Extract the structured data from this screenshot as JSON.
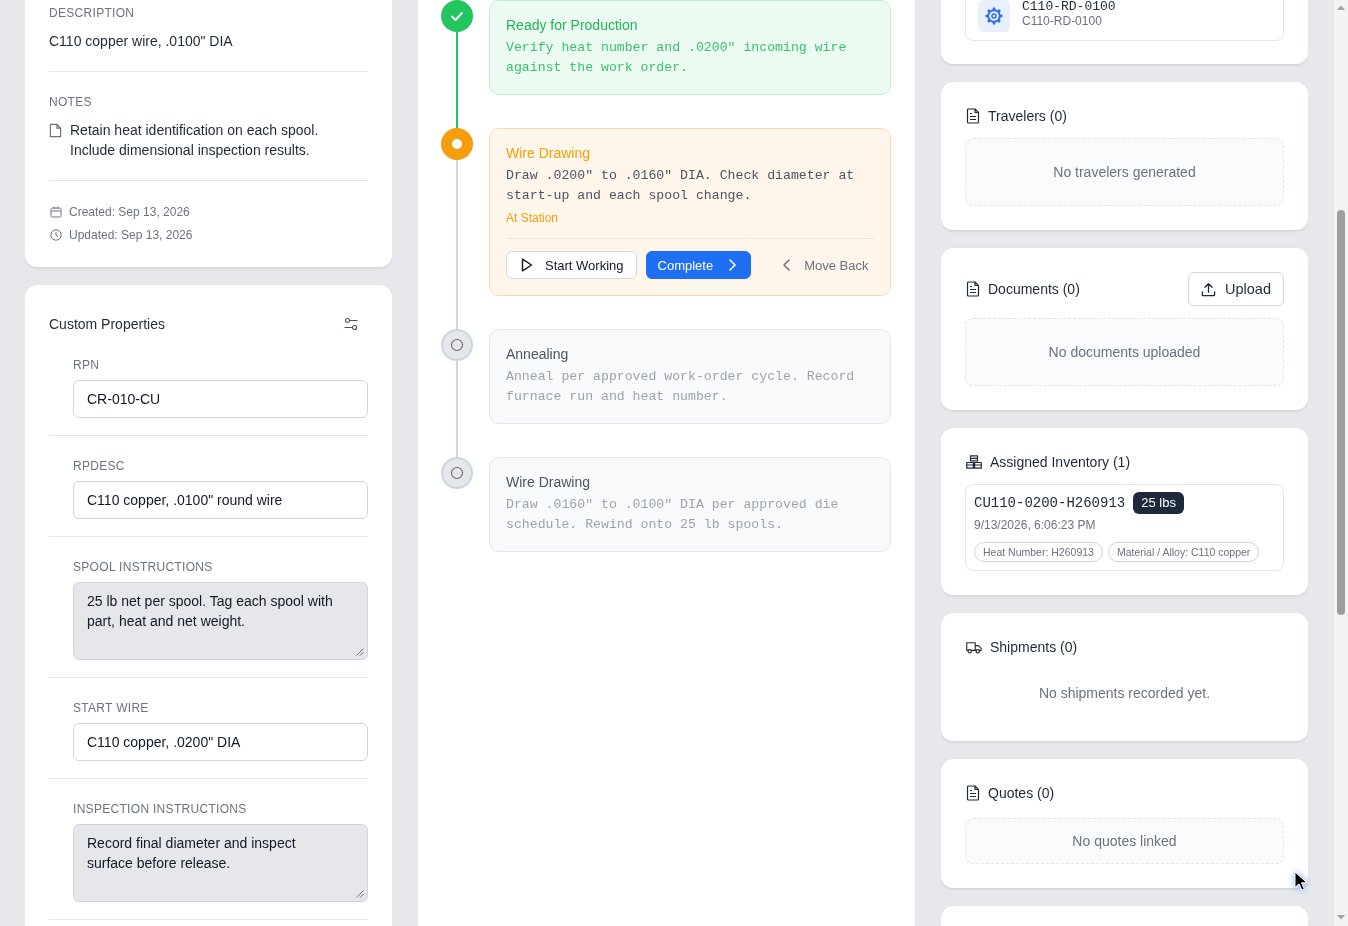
{
  "details": {
    "fields": [
      {
        "label": "DESCRIPTION",
        "value": "C110 copper wire, .0100\" DIA",
        "kind": "text"
      },
      {
        "label": "NOTES",
        "value": "Retain heat identification on each spool. Include dimensional inspection results.",
        "kind": "note"
      }
    ],
    "meta": [
      {
        "kind": "created",
        "text": "Created: Sep 13, 2026"
      },
      {
        "kind": "updated",
        "text": "Updated: Sep 13, 2026"
      }
    ]
  },
  "custom_properties": {
    "title": "Custom Properties",
    "properties": [
      {
        "label": "RPN",
        "value": "CR-010-CU",
        "kind": "input"
      },
      {
        "label": "RPDESC",
        "value": "C110 copper, .0100\" round wire",
        "kind": "input"
      },
      {
        "label": "SPOOL INSTRUCTIONS",
        "value": "25 lb net per spool. Tag each spool with part, heat and net weight.",
        "kind": "textarea"
      },
      {
        "label": "START WIRE",
        "value": "C110 copper, .0200\" DIA",
        "kind": "input"
      },
      {
        "label": "INSPECTION INSTRUCTIONS",
        "value": "Record final diameter and inspect surface before release.",
        "kind": "textarea"
      }
    ]
  },
  "steps": [
    {
      "title": "Ready for Production",
      "description": "Verify heat number and .0200\" incoming wire against the work order.",
      "kind": "completed"
    },
    {
      "title": "Wire Drawing",
      "description": "Draw .0200\" to .0160\" DIA. Check diameter at start-up and each spool change.",
      "kind": "current",
      "badge": "At Station",
      "actions": [
        {
          "label": "Start Working",
          "kind": "start"
        },
        {
          "label": "Complete",
          "kind": "complete"
        },
        {
          "label": "Move Back",
          "kind": "back"
        }
      ]
    },
    {
      "title": "Annealing",
      "description": "Anneal per approved work-order cycle. Record furnace run and heat number.",
      "kind": "pending"
    },
    {
      "title": "Wire Drawing",
      "description": "Draw .0160\" to .0100\" DIA per approved die schedule. Rewind onto 25 lb spools.",
      "kind": "pending"
    }
  ],
  "routing": {
    "title": "C110-RD-0100",
    "subtitle": "C110-RD-0100"
  },
  "sections": [
    {
      "kind": "files",
      "title": "Travelers (0)",
      "empty": {
        "text": "No travelers generated",
        "kind": "box"
      }
    },
    {
      "kind": "files",
      "title": "Documents (0)",
      "action": "Upload",
      "empty": {
        "text": "No documents uploaded",
        "kind": "box"
      }
    },
    {
      "kind": "inventory",
      "title": "Assigned Inventory (1)",
      "items": [
        {
          "code": "CU110-0200-H260913",
          "quantity": "25 lbs",
          "timestamp": "9/13/2026, 6:06:23 PM",
          "tags": [
            "Heat Number: H260913",
            "Material / Alloy: C110 copper"
          ]
        }
      ]
    },
    {
      "kind": "shipments",
      "title": "Shipments (0)",
      "empty": {
        "text": "No shipments recorded yet.",
        "kind": "text"
      }
    },
    {
      "kind": "files",
      "title": "Quotes (0)",
      "empty": {
        "text": "No quotes linked",
        "kind": "compact"
      }
    }
  ]
}
